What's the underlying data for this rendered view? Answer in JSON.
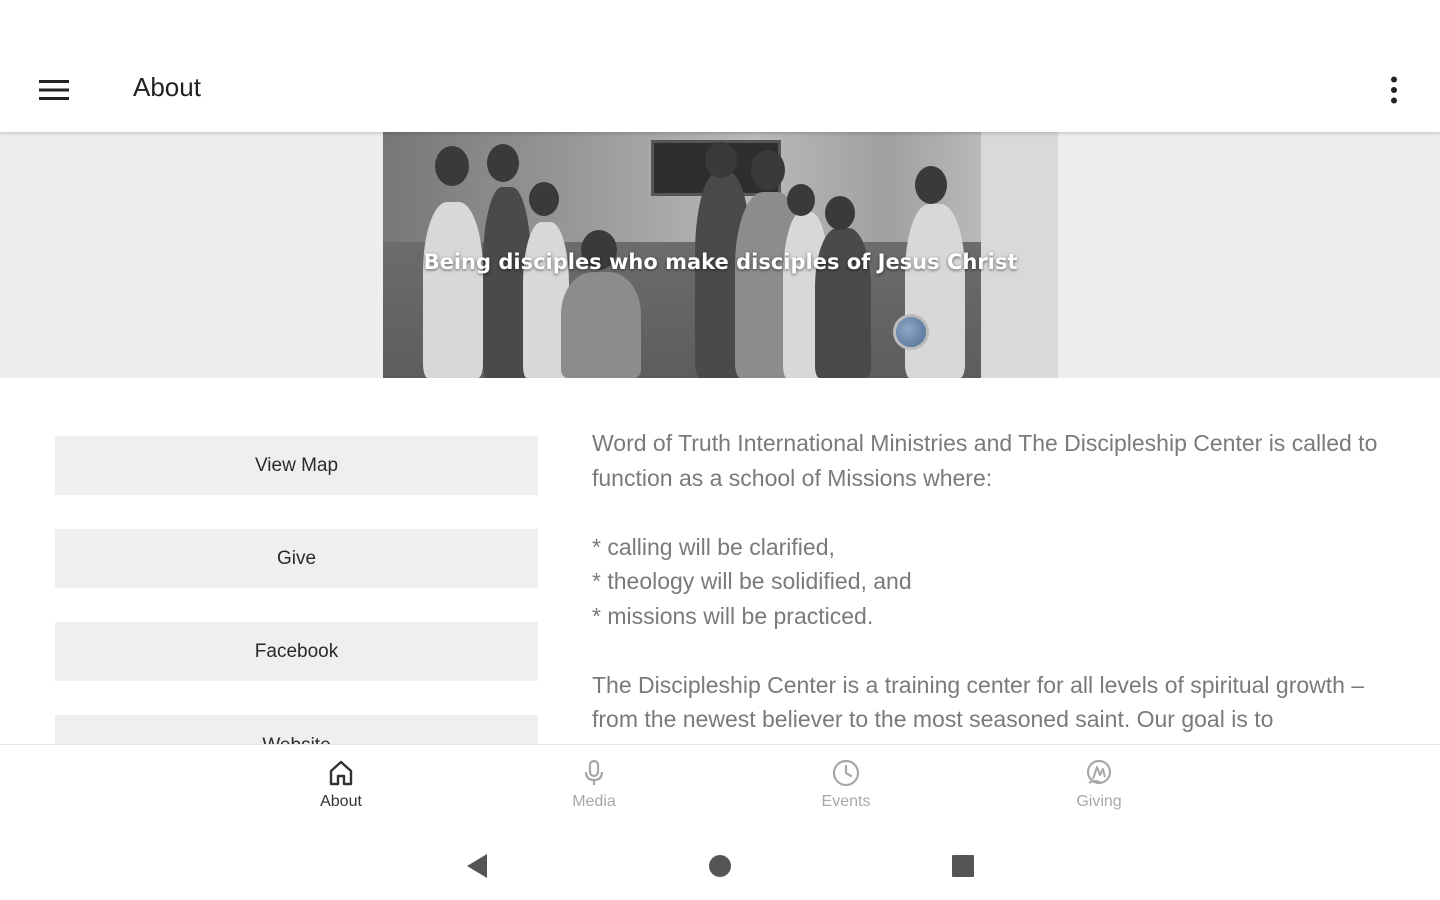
{
  "app_bar": {
    "title": "About"
  },
  "hero": {
    "caption": "Being disciples who make disciples of Jesus Christ"
  },
  "links": [
    {
      "label": "View Map"
    },
    {
      "label": "Give"
    },
    {
      "label": "Facebook"
    },
    {
      "label": "Website"
    }
  ],
  "about": {
    "intro": "Word of Truth International Ministries and The Discipleship Center is called to function as a school of Missions where:",
    "bullets": [
      "* calling will be clarified,",
      "* theology will be solidified, and",
      "* missions will be practiced."
    ],
    "body": "The Discipleship Center is a training center for all levels of spiritual growth – from the newest believer to the most seasoned saint.  Our goal is to"
  },
  "bottom_nav": [
    {
      "label": "About",
      "icon": "home-icon",
      "active": true
    },
    {
      "label": "Media",
      "icon": "microphone-icon",
      "active": false
    },
    {
      "label": "Events",
      "icon": "clock-icon",
      "active": false
    },
    {
      "label": "Giving",
      "icon": "giving-icon",
      "active": false
    }
  ],
  "colors": {
    "accent": "#333333",
    "inactive": "#a8a8a8",
    "button_bg": "#eeeff0",
    "body_text": "#7a7a7a"
  }
}
